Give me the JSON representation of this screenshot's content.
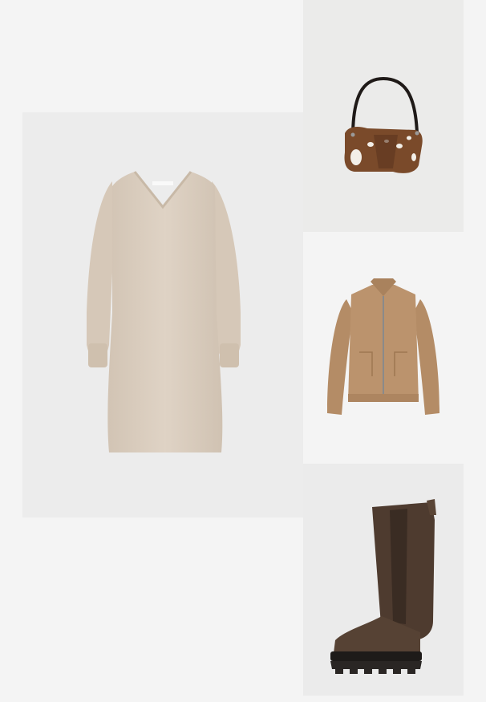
{
  "outfit": {
    "items": [
      {
        "id": "dress",
        "icon": "knit-dress-icon",
        "color": "#d9ccbd"
      },
      {
        "id": "bag",
        "icon": "shoulder-bag-icon",
        "color": "#7a4a2a"
      },
      {
        "id": "jacket",
        "icon": "suede-jacket-icon",
        "color": "#b8916b"
      },
      {
        "id": "boot",
        "icon": "chelsea-boot-icon",
        "color": "#4e3b2f"
      }
    ]
  },
  "colors": {
    "page_bg": "#f4f4f4",
    "tile_bg": "#ececec"
  }
}
